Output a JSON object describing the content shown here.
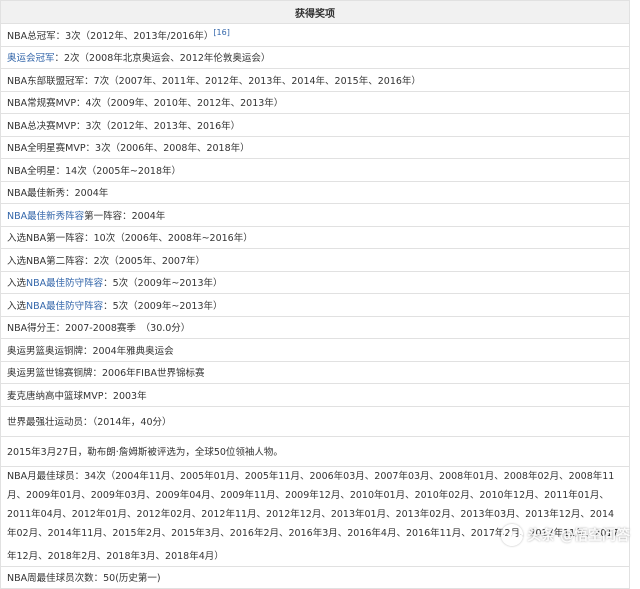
{
  "table": {
    "header": "获得奖项",
    "rows": [
      {
        "pre": "NBA总冠军：3次（2012年、2013年/2016年）",
        "link": "",
        "post": "",
        "sup": "[16]"
      },
      {
        "pre": "",
        "link": "奥运会冠军",
        "post": "：2次（2008年北京奥运会、2012年伦敦奥运会）",
        "sup": ""
      },
      {
        "pre": "NBA东部联盟冠军：7次（2007年、2011年、2012年、2013年、2014年、2015年、2016年）",
        "link": "",
        "post": "",
        "sup": ""
      },
      {
        "pre": "NBA常规赛MVP：4次（2009年、2010年、2012年、2013年）",
        "link": "",
        "post": "",
        "sup": ""
      },
      {
        "pre": "NBA总决赛MVP：3次（2012年、2013年、2016年）",
        "link": "",
        "post": "",
        "sup": ""
      },
      {
        "pre": "NBA全明星赛MVP：3次（2006年、2008年、2018年）",
        "link": "",
        "post": "",
        "sup": ""
      },
      {
        "pre": "NBA全明星：14次（2005年~2018年）",
        "link": "",
        "post": "",
        "sup": ""
      },
      {
        "pre": "NBA最佳新秀：2004年",
        "link": "",
        "post": "",
        "sup": ""
      },
      {
        "pre": "",
        "link": "NBA最佳新秀阵容",
        "post": "第一阵容：2004年",
        "sup": ""
      },
      {
        "pre": "入选NBA第一阵容：10次（2006年、2008年~2016年）",
        "link": "",
        "post": "",
        "sup": ""
      },
      {
        "pre": "入选NBA第二阵容：2次（2005年、2007年）",
        "link": "",
        "post": "",
        "sup": ""
      },
      {
        "pre": "入选",
        "link": "NBA最佳防守阵容",
        "post": "：5次（2009年~2013年）",
        "sup": ""
      },
      {
        "pre": "入选",
        "link": "NBA最佳防守阵容",
        "post": "：5次（2009年~2013年）",
        "sup": ""
      },
      {
        "pre": "NBA得分王：2007-2008赛季　（30.0分）",
        "link": "",
        "post": "",
        "sup": ""
      },
      {
        "pre": "奥运男篮奥运铜牌：2004年雅典奥运会",
        "link": "",
        "post": "",
        "sup": ""
      },
      {
        "pre": "奥运男篮世锦赛铜牌：2006年FIBA世界锦标赛",
        "link": "",
        "post": "",
        "sup": ""
      },
      {
        "pre": "麦克唐纳高中篮球MVP：2003年",
        "link": "",
        "post": "",
        "sup": ""
      },
      {
        "pre": "世界最强壮运动员：（2014年，40分）",
        "link": "",
        "post": "",
        "sup": ""
      },
      {
        "pre": "2015年3月27日，勒布朗·詹姆斯被评选为，全球50位领袖人物。",
        "link": "",
        "post": "",
        "sup": ""
      },
      {
        "pre": "NBA月最佳球员：34次（2004年11月、2005年01月、2005年11月、2006年03月、2007年03月、2008年01月、2008年02月、2008年11月、2009年01月、2009年03月、2009年04月、2009年11月、2009年12月、2010年01月、2010年02月、2010年12月、2011年01月、2011年04月、2012年01月、2012年02月、2012年11月、2012年12月、2013年01月、2013年02月、2013年03月、2013年12月、2014年02月、2014年11月、2015年2月、2015年3月、2016年2月、2016年3月、2016年4月、2016年11月、2017年2月、2017年11月、2017年12月、2018年2月、2018年3月、2018年4月）",
        "link": "",
        "post": "",
        "sup": ""
      },
      {
        "pre": "NBA周最佳球员次数：50(历史第一)",
        "link": "",
        "post": "",
        "sup": ""
      }
    ]
  },
  "watermark": {
    "text": "头条 @悟空问答",
    "icon": "wukong-logo-icon"
  }
}
